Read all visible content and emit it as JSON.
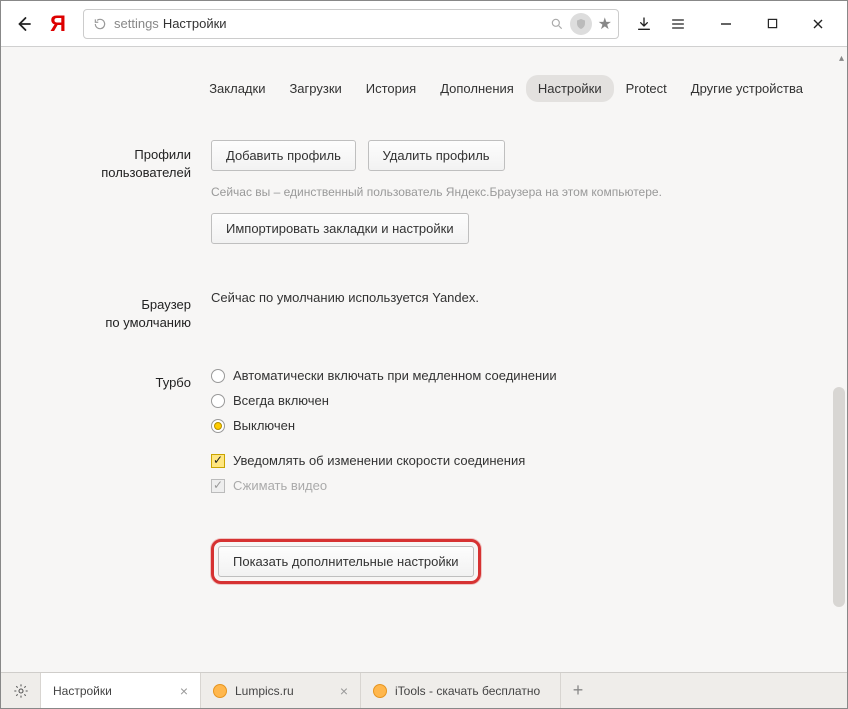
{
  "titlebar": {
    "url_prefix": "settings",
    "url_rest": "Настройки"
  },
  "nav": {
    "tabs": [
      {
        "label": "Закладки"
      },
      {
        "label": "Загрузки"
      },
      {
        "label": "История"
      },
      {
        "label": "Дополнения"
      },
      {
        "label": "Настройки",
        "active": true
      },
      {
        "label": "Protect"
      },
      {
        "label": "Другие устройства"
      }
    ]
  },
  "sections": {
    "profiles": {
      "title_l1": "Профили",
      "title_l2": "пользователей",
      "add_btn": "Добавить профиль",
      "delete_btn": "Удалить профиль",
      "hint": "Сейчас вы – единственный пользователь Яндекс.Браузера на этом компьютере.",
      "import_btn": "Импортировать закладки и настройки"
    },
    "default_browser": {
      "title_l1": "Браузер",
      "title_l2": "по умолчанию",
      "text": "Сейчас по умолчанию используется Yandex."
    },
    "turbo": {
      "title": "Турбо",
      "opt_auto": "Автоматически включать при медленном соединении",
      "opt_always": "Всегда включен",
      "opt_off": "Выключен",
      "chk_notify": "Уведомлять об изменении скорости соединения",
      "chk_compress": "Сжимать видео"
    },
    "advanced": {
      "btn": "Показать дополнительные настройки"
    }
  },
  "tabstrip": {
    "tabs": [
      {
        "label": "Настройки",
        "active": true,
        "favicon": "none"
      },
      {
        "label": "Lumpics.ru",
        "favicon": "orange"
      },
      {
        "label": "iTools - скачать бесплатно",
        "favicon": "orange"
      }
    ]
  }
}
